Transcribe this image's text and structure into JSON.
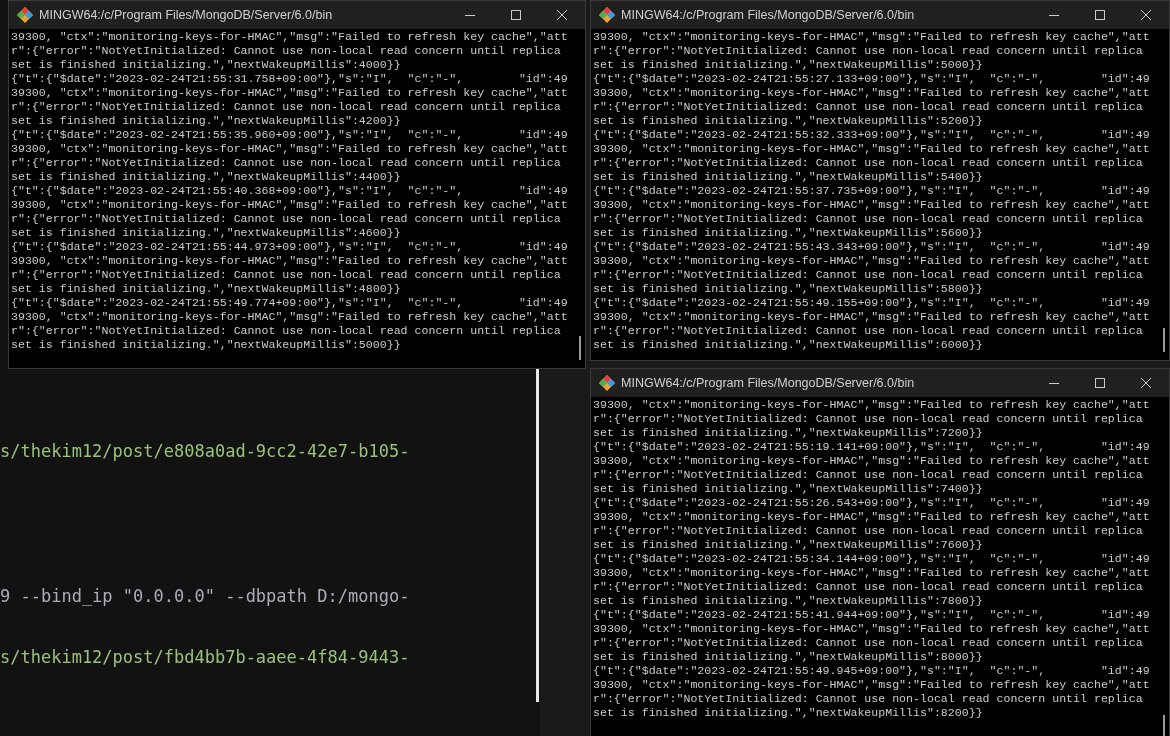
{
  "editor": {
    "lines": [
      {
        "kind": "string",
        "text": "s/thekim12/post/e808a0ad-9cc2-42e7-b105-"
      },
      {
        "kind": "command",
        "text": "9 --bind_ip \"0.0.0.0\" --dbpath D:/mongo-"
      },
      {
        "kind": "string",
        "text": "s/thekim12/post/fbd4bb7b-aaee-4f84-9443-"
      }
    ]
  },
  "terminals": [
    {
      "title": "MINGW64:/c/Program Files/MongoDB/Server/6.0/bin",
      "lines": [
        "39300, \"ctx\":\"monitoring-keys-for-HMAC\",\"msg\":\"Failed to refresh key cache\",\"att",
        "r\":{\"error\":\"NotYetInitialized: Cannot use non-local read concern until replica",
        "set is finished initializing.\",\"nextWakeupMillis\":4000}}",
        "{\"t\":{\"$date\":\"2023-02-24T21:55:31.758+09:00\"},\"s\":\"I\",  \"c\":\"-\",        \"id\":49",
        "39300, \"ctx\":\"monitoring-keys-for-HMAC\",\"msg\":\"Failed to refresh key cache\",\"att",
        "r\":{\"error\":\"NotYetInitialized: Cannot use non-local read concern until replica",
        "set is finished initializing.\",\"nextWakeupMillis\":4200}}",
        "{\"t\":{\"$date\":\"2023-02-24T21:55:35.960+09:00\"},\"s\":\"I\",  \"c\":\"-\",        \"id\":49",
        "39300, \"ctx\":\"monitoring-keys-for-HMAC\",\"msg\":\"Failed to refresh key cache\",\"att",
        "r\":{\"error\":\"NotYetInitialized: Cannot use non-local read concern until replica",
        "set is finished initializing.\",\"nextWakeupMillis\":4400}}",
        "{\"t\":{\"$date\":\"2023-02-24T21:55:40.368+09:00\"},\"s\":\"I\",  \"c\":\"-\",        \"id\":49",
        "39300, \"ctx\":\"monitoring-keys-for-HMAC\",\"msg\":\"Failed to refresh key cache\",\"att",
        "r\":{\"error\":\"NotYetInitialized: Cannot use non-local read concern until replica",
        "set is finished initializing.\",\"nextWakeupMillis\":4600}}",
        "{\"t\":{\"$date\":\"2023-02-24T21:55:44.973+09:00\"},\"s\":\"I\",  \"c\":\"-\",        \"id\":49",
        "39300, \"ctx\":\"monitoring-keys-for-HMAC\",\"msg\":\"Failed to refresh key cache\",\"att",
        "r\":{\"error\":\"NotYetInitialized: Cannot use non-local read concern until replica",
        "set is finished initializing.\",\"nextWakeupMillis\":4800}}",
        "{\"t\":{\"$date\":\"2023-02-24T21:55:49.774+09:00\"},\"s\":\"I\",  \"c\":\"-\",        \"id\":49",
        "39300, \"ctx\":\"monitoring-keys-for-HMAC\",\"msg\":\"Failed to refresh key cache\",\"att",
        "r\":{\"error\":\"NotYetInitialized: Cannot use non-local read concern until replica",
        "set is finished initializing.\",\"nextWakeupMillis\":5000}}"
      ]
    },
    {
      "title": "MINGW64:/c/Program Files/MongoDB/Server/6.0/bin",
      "lines": [
        "39300, \"ctx\":\"monitoring-keys-for-HMAC\",\"msg\":\"Failed to refresh key cache\",\"att",
        "r\":{\"error\":\"NotYetInitialized: Cannot use non-local read concern until replica",
        "set is finished initializing.\",\"nextWakeupMillis\":5000}}",
        "{\"t\":{\"$date\":\"2023-02-24T21:55:27.133+09:00\"},\"s\":\"I\",  \"c\":\"-\",        \"id\":49",
        "39300, \"ctx\":\"monitoring-keys-for-HMAC\",\"msg\":\"Failed to refresh key cache\",\"att",
        "r\":{\"error\":\"NotYetInitialized: Cannot use non-local read concern until replica",
        "set is finished initializing.\",\"nextWakeupMillis\":5200}}",
        "{\"t\":{\"$date\":\"2023-02-24T21:55:32.333+09:00\"},\"s\":\"I\",  \"c\":\"-\",        \"id\":49",
        "39300, \"ctx\":\"monitoring-keys-for-HMAC\",\"msg\":\"Failed to refresh key cache\",\"att",
        "r\":{\"error\":\"NotYetInitialized: Cannot use non-local read concern until replica",
        "set is finished initializing.\",\"nextWakeupMillis\":5400}}",
        "{\"t\":{\"$date\":\"2023-02-24T21:55:37.735+09:00\"},\"s\":\"I\",  \"c\":\"-\",        \"id\":49",
        "39300, \"ctx\":\"monitoring-keys-for-HMAC\",\"msg\":\"Failed to refresh key cache\",\"att",
        "r\":{\"error\":\"NotYetInitialized: Cannot use non-local read concern until replica",
        "set is finished initializing.\",\"nextWakeupMillis\":5600}}",
        "{\"t\":{\"$date\":\"2023-02-24T21:55:43.343+09:00\"},\"s\":\"I\",  \"c\":\"-\",        \"id\":49",
        "39300, \"ctx\":\"monitoring-keys-for-HMAC\",\"msg\":\"Failed to refresh key cache\",\"att",
        "r\":{\"error\":\"NotYetInitialized: Cannot use non-local read concern until replica",
        "set is finished initializing.\",\"nextWakeupMillis\":5800}}",
        "{\"t\":{\"$date\":\"2023-02-24T21:55:49.155+09:00\"},\"s\":\"I\",  \"c\":\"-\",        \"id\":49",
        "39300, \"ctx\":\"monitoring-keys-for-HMAC\",\"msg\":\"Failed to refresh key cache\",\"att",
        "r\":{\"error\":\"NotYetInitialized: Cannot use non-local read concern until replica",
        "set is finished initializing.\",\"nextWakeupMillis\":6000}}"
      ]
    },
    {
      "title": "MINGW64:/c/Program Files/MongoDB/Server/6.0/bin",
      "lines": [
        "39300, \"ctx\":\"monitoring-keys-for-HMAC\",\"msg\":\"Failed to refresh key cache\",\"att",
        "r\":{\"error\":\"NotYetInitialized: Cannot use non-local read concern until replica",
        "set is finished initializing.\",\"nextWakeupMillis\":7200}}",
        "{\"t\":{\"$date\":\"2023-02-24T21:55:19.141+09:00\"},\"s\":\"I\",  \"c\":\"-\",        \"id\":49",
        "39300, \"ctx\":\"monitoring-keys-for-HMAC\",\"msg\":\"Failed to refresh key cache\",\"att",
        "r\":{\"error\":\"NotYetInitialized: Cannot use non-local read concern until replica",
        "set is finished initializing.\",\"nextWakeupMillis\":7400}}",
        "{\"t\":{\"$date\":\"2023-02-24T21:55:26.543+09:00\"},\"s\":\"I\",  \"c\":\"-\",        \"id\":49",
        "39300, \"ctx\":\"monitoring-keys-for-HMAC\",\"msg\":\"Failed to refresh key cache\",\"att",
        "r\":{\"error\":\"NotYetInitialized: Cannot use non-local read concern until replica",
        "set is finished initializing.\",\"nextWakeupMillis\":7600}}",
        "{\"t\":{\"$date\":\"2023-02-24T21:55:34.144+09:00\"},\"s\":\"I\",  \"c\":\"-\",        \"id\":49",
        "39300, \"ctx\":\"monitoring-keys-for-HMAC\",\"msg\":\"Failed to refresh key cache\",\"att",
        "r\":{\"error\":\"NotYetInitialized: Cannot use non-local read concern until replica",
        "set is finished initializing.\",\"nextWakeupMillis\":7800}}",
        "{\"t\":{\"$date\":\"2023-02-24T21:55:41.944+09:00\"},\"s\":\"I\",  \"c\":\"-\",        \"id\":49",
        "39300, \"ctx\":\"monitoring-keys-for-HMAC\",\"msg\":\"Failed to refresh key cache\",\"att",
        "r\":{\"error\":\"NotYetInitialized: Cannot use non-local read concern until replica",
        "set is finished initializing.\",\"nextWakeupMillis\":8000}}",
        "{\"t\":{\"$date\":\"2023-02-24T21:55:49.945+09:00\"},\"s\":\"I\",  \"c\":\"-\",        \"id\":49",
        "39300, \"ctx\":\"monitoring-keys-for-HMAC\",\"msg\":\"Failed to refresh key cache\",\"att",
        "r\":{\"error\":\"NotYetInitialized: Cannot use non-local read concern until replica",
        "set is finished initializing.\",\"nextWakeupMillis\":8200}}"
      ]
    }
  ]
}
